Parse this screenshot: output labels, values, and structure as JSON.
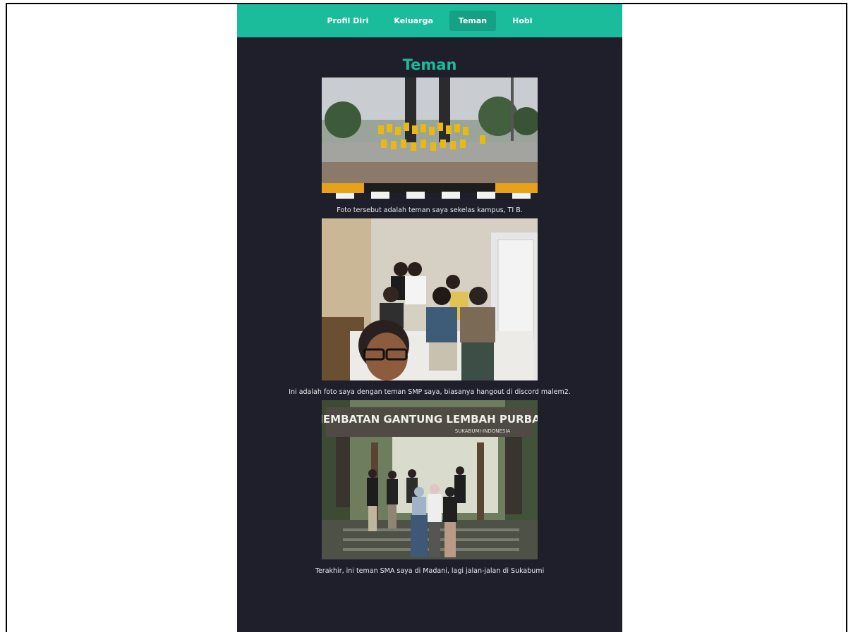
{
  "nav": {
    "items": [
      {
        "label": "Profil Diri"
      },
      {
        "label": "Keluarga"
      },
      {
        "label": "Teman",
        "active": true
      },
      {
        "label": "Hobi"
      }
    ]
  },
  "page_title": "Teman",
  "photos": [
    {
      "caption": "Foto tersebut adalah teman saya sekelas kampus, TI B."
    },
    {
      "caption": "Ini adalah foto saya dengan teman SMP saya, biasanya hangout di discord malem2."
    },
    {
      "caption": "Terakhir, ini teman SMA saya di Madani, lagi jalan-jalan di Sukabumi",
      "sign_text": "JEMBATAN GANTUNG LEMBAH PURBA",
      "sign_subtext": "SUKABUMI-INDONESIA"
    }
  ],
  "colors": {
    "accent": "#1abc9c",
    "accent_dark": "#16a085",
    "background": "#1f1f2b"
  }
}
